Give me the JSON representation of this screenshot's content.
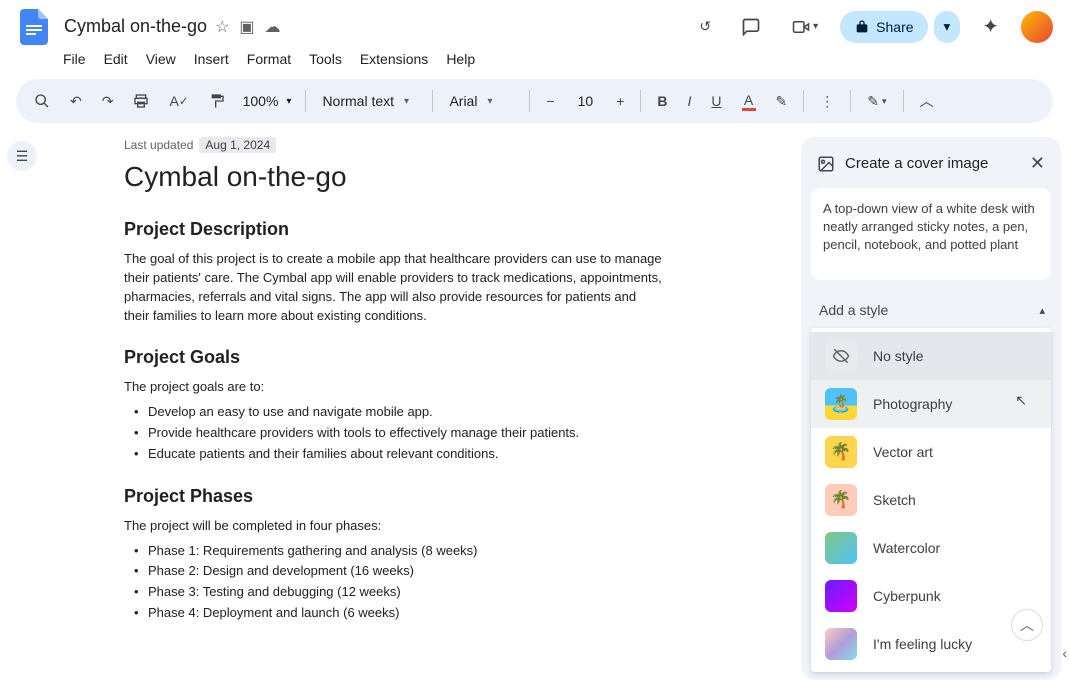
{
  "header": {
    "title": "Cymbal on-the-go",
    "share_label": "Share"
  },
  "menu": {
    "file": "File",
    "edit": "Edit",
    "view": "View",
    "insert": "Insert",
    "format": "Format",
    "tools": "Tools",
    "extensions": "Extensions",
    "help": "Help"
  },
  "toolbar": {
    "zoom": "100%",
    "style": "Normal text",
    "font": "Arial",
    "font_size": "10"
  },
  "document": {
    "last_updated_label": "Last updated",
    "last_updated_date": "Aug 1, 2024",
    "h1": "Cymbal on-the-go",
    "desc_heading": "Project Description",
    "desc_text": "The goal of this project is to create a mobile app that healthcare providers can use to manage their patients' care.  The Cymbal app will enable providers to track medications, appointments, pharmacies, referrals and vital signs. The app will also provide resources for patients and their families to learn more about existing conditions.",
    "goals_heading": "Project Goals",
    "goals_intro": "The project goals are to:",
    "goals": [
      "Develop an easy to use and navigate mobile app.",
      "Provide healthcare providers with tools to effectively  manage their patients.",
      "Educate patients and their families about relevant conditions."
    ],
    "phases_heading": "Project Phases",
    "phases_intro": "The project will be completed in four phases:",
    "phases": [
      "Phase 1: Requirements gathering and analysis (8 weeks)",
      "Phase 2: Design and development (16 weeks)",
      "Phase 3: Testing and debugging (12 weeks)",
      "Phase 4: Deployment and launch (6 weeks)"
    ]
  },
  "panel": {
    "title": "Create a cover image",
    "prompt": "A top-down view of a white desk with neatly arranged sticky notes, a pen, pencil, notebook, and potted plant",
    "dropdown_label": "Add a style",
    "styles": {
      "no_style": "No style",
      "photography": "Photography",
      "vector": "Vector art",
      "sketch": "Sketch",
      "watercolor": "Watercolor",
      "cyberpunk": "Cyberpunk",
      "lucky": "I'm feeling lucky"
    }
  }
}
